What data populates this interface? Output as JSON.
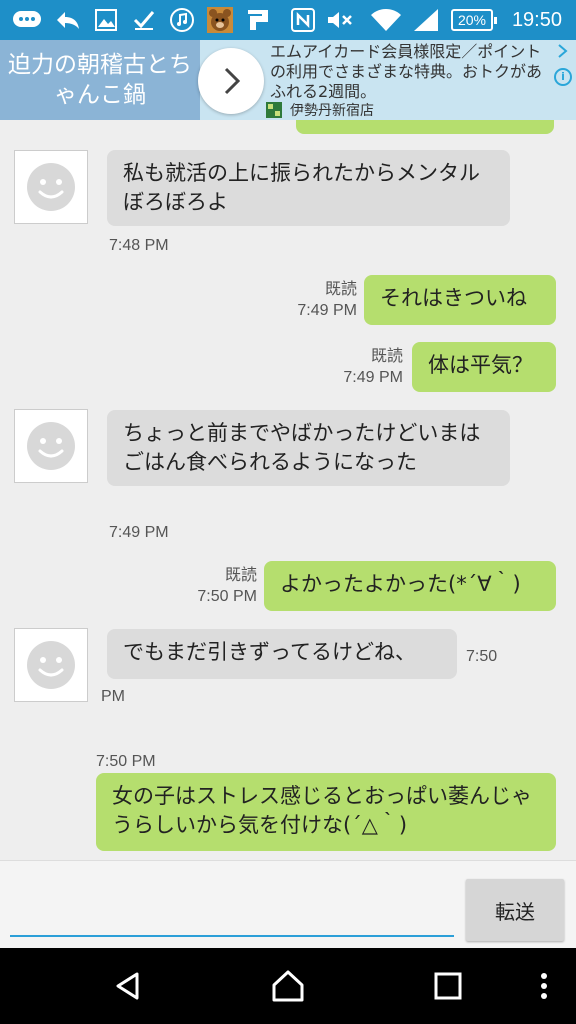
{
  "status_bar": {
    "time": "19:50",
    "battery": "20%",
    "icons": [
      "chat-notification-icon",
      "reply-icon",
      "image-icon",
      "checkmark-icon",
      "music-icon",
      "bear-app-icon",
      "p-app-icon",
      "nfc-icon",
      "mute-icon",
      "wifi-icon",
      "signal-icon",
      "battery-icon"
    ]
  },
  "ad": {
    "headline": "迫力の朝稽古とちゃんこ鍋",
    "body": "エムアイカード会員様限定／ポイントの利用でさまざまな特典。おトクがあふれる2週間。",
    "source": "伊勢丹新宿店",
    "arrow_icon": "chevron-right-icon",
    "close_icon": "close-icon",
    "info_icon": "info-icon"
  },
  "messages": [
    {
      "type": "recv",
      "text": "私も就活の上に振られたからメンタルぼろぼろよ",
      "time": "7:48 PM"
    },
    {
      "type": "sent",
      "text": "それはきついね",
      "read": "既読",
      "time": "7:49 PM"
    },
    {
      "type": "sent",
      "text": "体は平気？",
      "read": "既読",
      "time": "7:49 PM"
    },
    {
      "type": "recv",
      "text": "ちょっと前までやばかったけどいまはごはん食べられるようになった",
      "time": "7:49 PM"
    },
    {
      "type": "sent",
      "text": "よかったよかった(*´∀｀)",
      "read": "既読",
      "time": "7:50 PM"
    },
    {
      "type": "recv",
      "text": "でもまだ引きずってるけどね、",
      "time_part1": "7:50",
      "time_part2": "PM"
    },
    {
      "type": "sent",
      "text": "女の子はストレス感じるとおっぱい萎んじゃうらしいから気を付けな(´△｀)",
      "time": "7:50 PM"
    }
  ],
  "input": {
    "placeholder": "",
    "send_label": "転送"
  },
  "nav": {
    "back_icon": "back-icon",
    "home_icon": "home-icon",
    "recents_icon": "recents-icon",
    "menu_icon": "overflow-menu-icon"
  },
  "colors": {
    "status_bar": "#1e8fc8",
    "sent_bubble": "#b5de6e",
    "recv_bubble": "#dcdcdc",
    "input_underline": "#2b9fd8"
  }
}
